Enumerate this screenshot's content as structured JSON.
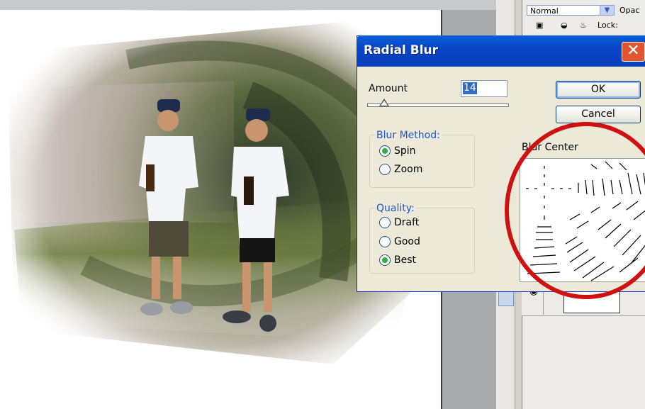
{
  "dialog": {
    "title": "Radial Blur",
    "amount_label": "Amount",
    "amount_value": "14",
    "ok_label": "OK",
    "cancel_label": "Cancel",
    "blur_method_label": "Blur Method:",
    "method_options": [
      "Spin",
      "Zoom"
    ],
    "method_selected": "Spin",
    "quality_label": "Quality:",
    "quality_options": [
      "Draft",
      "Good",
      "Best"
    ],
    "quality_selected": "Best",
    "blur_center_label": "Blur Center",
    "close_icon": "close-icon"
  },
  "layers_panel": {
    "blend_mode": "Normal",
    "opacity_label": "Opac",
    "lock_label": "Lock:"
  },
  "colors": {
    "title_bar": "#0845c6",
    "annotation_circle": "#d01111",
    "radio_selected": "#2fae3a"
  }
}
